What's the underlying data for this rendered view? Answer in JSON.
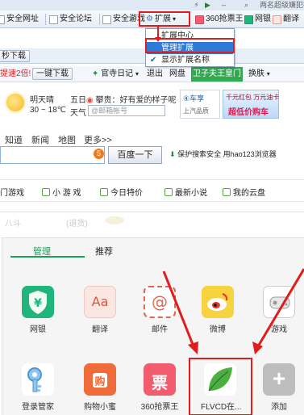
{
  "titlebar": {
    "right_text": "两名超级嫌犯被"
  },
  "favorites_bar": {
    "items": [
      "安全网址",
      "安全论坛",
      "安全游戏"
    ],
    "overflow": "»",
    "extension_menu_label": "扩展",
    "extension_menu_arrow": "▾",
    "right_items": [
      "360抢票王",
      "网银",
      "翻译"
    ],
    "right_arrow": "▾"
  },
  "extension_menu": {
    "items": [
      {
        "label": "扩展中心",
        "selected": false,
        "checked": false
      },
      {
        "label": "管理扩展",
        "selected": true,
        "checked": false
      },
      {
        "label": "显示扩展名称",
        "selected": false,
        "checked": true
      }
    ]
  },
  "toolbar_row": {
    "left_button": "秒下载"
  },
  "nav_row": {
    "promo_text": "提速2倍!",
    "download_button": "一键下载",
    "diary_label": "官寺日记",
    "diary_arrow": "▾",
    "exit": "退出",
    "netdisk": "网盘",
    "banner_tab": "卫子夫王皇门",
    "skin": "换肤",
    "skin_arrow": "▾"
  },
  "weather": {
    "day": "明天晴",
    "temp": "30 ~ 18℃",
    "weekday": "五日",
    "weekday_sub": "天气",
    "weibo_text": "攀贵：好有爱的样子呢",
    "mail_placeholder": "@邮箱帐号",
    "ad1_top": "④车享",
    "ad1_bottom": "上汽品质",
    "ad2_top": "千元红包 万元油卡",
    "ad2_bottom": "超低价购车"
  },
  "search": {
    "tabs": [
      "知道",
      "新闻",
      "地图",
      "更多>>"
    ],
    "badge": "5",
    "button": "百度一下",
    "shield_text": "保护搜索安全 用hao123浏览器"
  },
  "quick_links": [
    "门游戏",
    "小 游 戏",
    "今日特价",
    "最新小说",
    "我的云盘"
  ],
  "faint_bg": {
    "left": "八斗",
    "mid": "(退货)"
  },
  "panel": {
    "tabs": [
      "管理",
      "推荐"
    ],
    "active_tab": 0,
    "apps_row1": [
      {
        "name": "网银",
        "icon": "bank-shield-icon"
      },
      {
        "name": "翻译",
        "icon": "translate-icon",
        "glyph": "Aa"
      },
      {
        "name": "邮件",
        "icon": "mail-icon",
        "glyph": "@"
      },
      {
        "name": "微博",
        "icon": "weibo-icon"
      },
      {
        "name": "游戏",
        "icon": "game-controller-icon"
      }
    ],
    "apps_row2": [
      {
        "name": "登录管家",
        "icon": "key-icon"
      },
      {
        "name": "购物小蜜",
        "icon": "shopping-bag-icon",
        "glyph": "购"
      },
      {
        "name": "360抢票王",
        "icon": "ticket-icon",
        "glyph": "票"
      },
      {
        "name": "FLVCD在...",
        "icon": "leaf-icon"
      },
      {
        "name": "添加",
        "icon": "add-icon",
        "glyph": "+"
      }
    ]
  },
  "colors": {
    "accent_green": "#18a058",
    "highlight_red": "#e21b1b",
    "menu_selected": "#2d7bd8"
  }
}
